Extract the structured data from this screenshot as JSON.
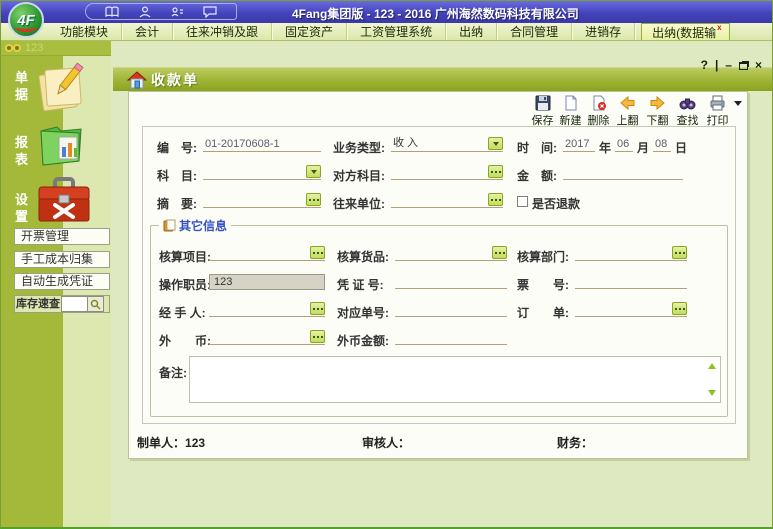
{
  "titlebar": {
    "logo": "4F",
    "title": "4Fang集团版 - 123 - 2016 广州海然数码科技有限公司",
    "quick_icons": [
      "book-icon",
      "user-icon",
      "contact-card-icon",
      "chat-icon"
    ]
  },
  "menu": {
    "items": [
      "功能模块",
      "会计",
      "往来冲销及跟",
      "固定资产",
      "工资管理系统",
      "出纳",
      "合同管理",
      "进销存"
    ],
    "active_tab": {
      "label": "出纳(数据输",
      "close": "x"
    }
  },
  "sidebar": {
    "workspace_label": "123",
    "nav": [
      {
        "label": "单据",
        "icon": "notepad-pencil-icon"
      },
      {
        "label": "报表",
        "icon": "report-folder-icon"
      },
      {
        "label": "设置",
        "icon": "toolbox-icon"
      }
    ],
    "buttons": [
      "开票管理",
      "手工成本归集",
      "自动生成凭证"
    ],
    "stock_query": {
      "label": "库存速查",
      "value": "",
      "icon": "magnifier-icon"
    }
  },
  "form": {
    "title": "收款单",
    "window_controls": {
      "help": "?",
      "divider": "|",
      "minimize": "–",
      "close": "×"
    },
    "toolbar": [
      {
        "name": "save",
        "label": "保存"
      },
      {
        "name": "new",
        "label": "新建"
      },
      {
        "name": "delete",
        "label": "删除"
      },
      {
        "name": "page-up",
        "label": "上翻"
      },
      {
        "name": "page-down",
        "label": "下翻"
      },
      {
        "name": "find",
        "label": "查找"
      },
      {
        "name": "print",
        "label": "打印"
      }
    ],
    "fields": {
      "number": {
        "label": "编　号:",
        "value": "01-20170608-1"
      },
      "biz_type": {
        "label": "业务类型:",
        "value": "收 入"
      },
      "time": {
        "label": "时　间:",
        "year": "2017",
        "year_unit": "年",
        "month": "06",
        "month_unit": "月",
        "day": "08",
        "day_unit": "日"
      },
      "subject": {
        "label": "科　目:",
        "value": ""
      },
      "counter_subject": {
        "label": "对方科目:",
        "value": ""
      },
      "amount": {
        "label": "金　额:",
        "value": ""
      },
      "summary": {
        "label": "摘　要:",
        "value": ""
      },
      "partner_unit": {
        "label": "往来单位:",
        "value": ""
      },
      "is_refund": {
        "label": "是否退款",
        "checked": false
      }
    },
    "other_info": {
      "legend": "其它信息",
      "accounting_item": {
        "label": "核算项目:",
        "value": ""
      },
      "accounting_goods": {
        "label": "核算货品:",
        "value": ""
      },
      "accounting_dept": {
        "label": "核算部门:",
        "value": ""
      },
      "operator": {
        "label": "操作职员:",
        "value": "123"
      },
      "voucher_no": {
        "label": "凭 证 号:",
        "value": ""
      },
      "ticket_no": {
        "label": "票　　号:",
        "value": ""
      },
      "handler": {
        "label": "经 手 人:",
        "value": ""
      },
      "related_no": {
        "label": "对应单号:",
        "value": ""
      },
      "order": {
        "label": "订　　单:",
        "value": ""
      },
      "foreign_currency": {
        "label": "外　　币:",
        "value": ""
      },
      "foreign_amount": {
        "label": "外币金额:",
        "value": ""
      },
      "remark": {
        "label": "备注:",
        "value": ""
      }
    },
    "footer": {
      "maker": {
        "label": "制单人：",
        "value": "123"
      },
      "auditor": {
        "label": "审核人：",
        "value": ""
      },
      "finance": {
        "label": "财务：",
        "value": ""
      }
    }
  }
}
